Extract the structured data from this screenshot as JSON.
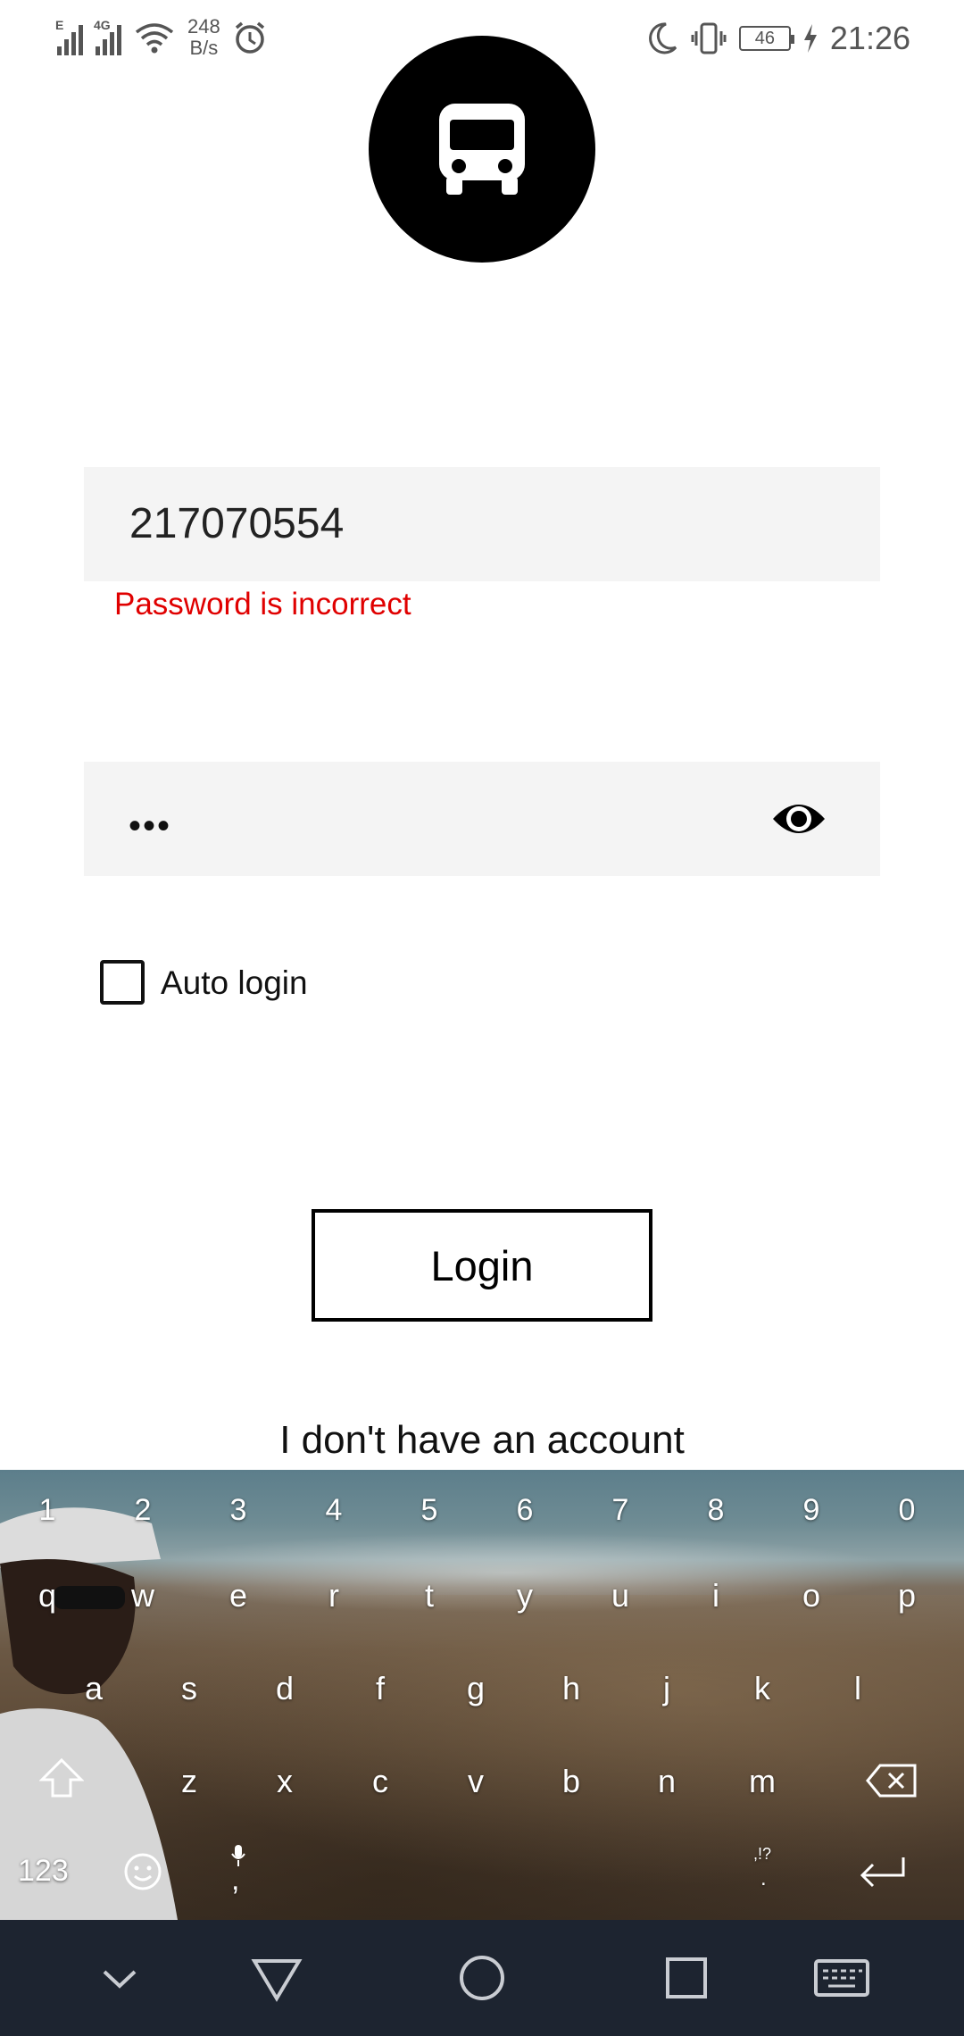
{
  "status_bar": {
    "signal1_tag": "E",
    "signal2_tag": "4G",
    "net_speed_value": "248",
    "net_speed_unit": "B/s",
    "battery_level": "46",
    "time": "21:26",
    "icons": [
      "signal-icon",
      "signal-4g-icon",
      "wifi-icon",
      "alarm-icon",
      "moon-icon",
      "vibrate-icon",
      "battery-icon",
      "charging-icon"
    ]
  },
  "logo": {
    "icon": "bus-icon"
  },
  "form": {
    "username_value": "217070554",
    "error_message": "Password is incorrect",
    "password_mask": "•••",
    "auto_login_label": "Auto login",
    "auto_login_checked": false,
    "login_button": "Login",
    "no_account_link": "I don't have an account"
  },
  "colors": {
    "error": "#e00000",
    "field_bg": "#f4f4f4",
    "navbar_bg": "#1d2430"
  },
  "keyboard": {
    "row_numbers": [
      "1",
      "2",
      "3",
      "4",
      "5",
      "6",
      "7",
      "8",
      "9",
      "0"
    ],
    "row1": [
      "q",
      "w",
      "e",
      "r",
      "t",
      "y",
      "u",
      "i",
      "o",
      "p"
    ],
    "row2": [
      "a",
      "s",
      "d",
      "f",
      "g",
      "h",
      "j",
      "k",
      "l"
    ],
    "row3": [
      "z",
      "x",
      "c",
      "v",
      "b",
      "n",
      "m"
    ],
    "mode_key": "123",
    "comma_key": ",",
    "punct_key_top": ",!?",
    "punct_key_bottom": ".",
    "icons": [
      "shift-icon",
      "backspace-icon",
      "emoji-icon",
      "mic-icon",
      "enter-icon"
    ]
  },
  "navigation_bar": {
    "icons": [
      "hide-keyboard-icon",
      "back-icon",
      "home-icon",
      "recents-icon",
      "keyboard-switch-icon"
    ]
  }
}
